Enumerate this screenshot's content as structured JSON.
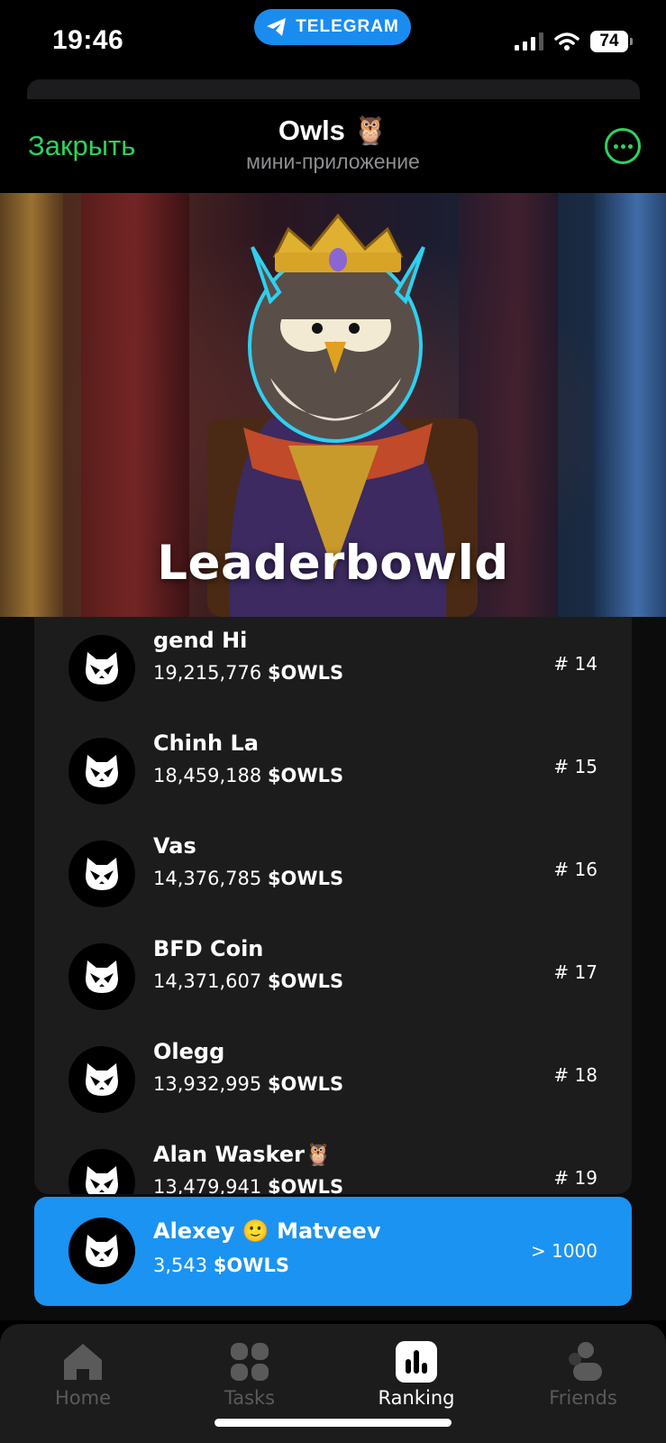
{
  "status_bar": {
    "time": "19:46",
    "pill_label": "TELEGRAM",
    "battery": "74"
  },
  "header": {
    "close_label": "Закрыть",
    "title": "Owls 🦉",
    "subtitle": "мини-приложение"
  },
  "hero": {
    "title": "Leaderbowld"
  },
  "currency": "$OWLS",
  "leaderboard": [
    {
      "name": "gend Hi",
      "score": "19,215,776",
      "rank": "# 14"
    },
    {
      "name": "Chinh La",
      "score": "18,459,188",
      "rank": "# 15"
    },
    {
      "name": "Vas",
      "score": "14,376,785",
      "rank": "# 16"
    },
    {
      "name": "BFD Coin",
      "score": "14,371,607",
      "rank": "# 17"
    },
    {
      "name": "Olegg",
      "score": "13,932,995",
      "rank": "# 18"
    },
    {
      "name": "Alan Wasker🦉",
      "score": "13,479,941",
      "rank": "# 19"
    }
  ],
  "me": {
    "name": "Alexey 🙂 Matveev",
    "score": "3,543",
    "rank": "> 1000",
    "highlight_color": "#1b93f2"
  },
  "nav": [
    {
      "label": "Home",
      "icon": "home-icon"
    },
    {
      "label": "Tasks",
      "icon": "tasks-icon"
    },
    {
      "label": "Ranking",
      "icon": "ranking-icon",
      "active": true
    },
    {
      "label": "Friends",
      "icon": "friends-icon"
    }
  ],
  "colors": {
    "accent_green": "#2fd15e",
    "telegram_blue": "#1a8cf0"
  }
}
